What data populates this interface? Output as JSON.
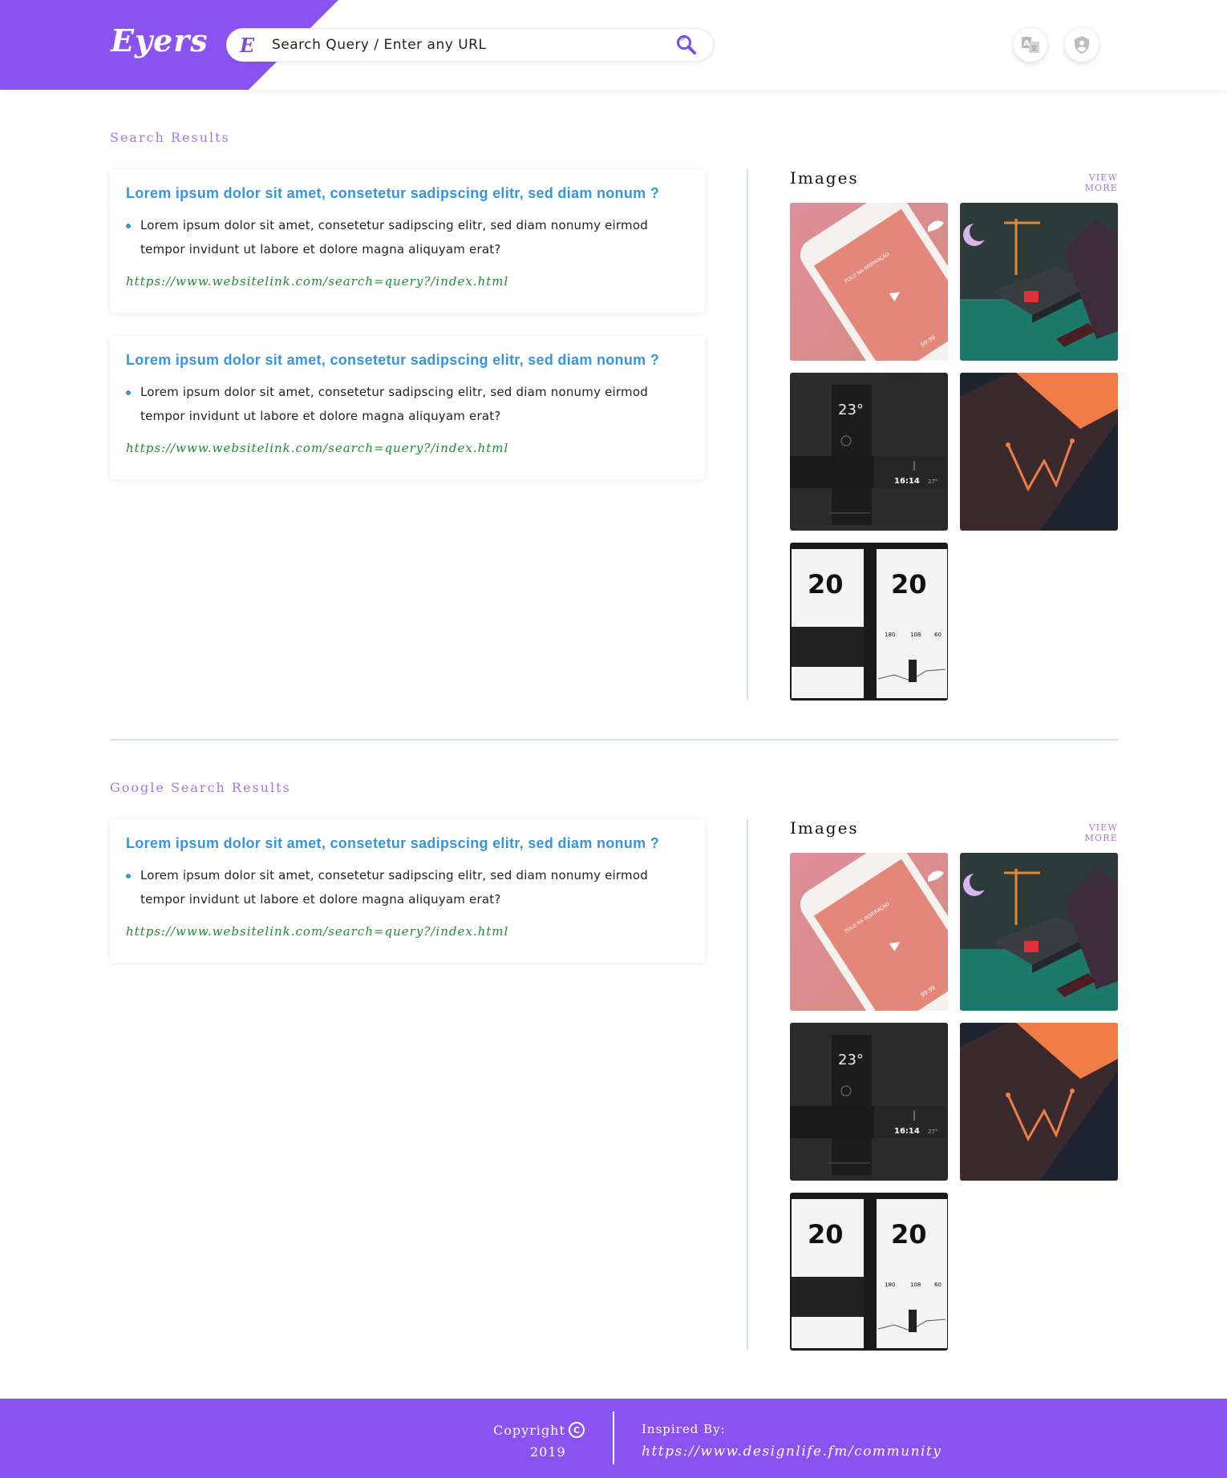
{
  "header": {
    "logo": "Eyers",
    "search_prefix": "E",
    "search_placeholder": "Search Query / Enter any URL",
    "search_icon": "search-icon",
    "icons": [
      "translate-icon",
      "shield-user-icon"
    ],
    "brand_color": "#8a53f0"
  },
  "sections": [
    {
      "title": "Search Results",
      "results": [
        {
          "title": "Lorem ipsum dolor sit amet, consetetur sadipscing elitr, sed diam nonum ?",
          "description": "Lorem ipsum dolor sit amet, consetetur sadipscing elitr, sed diam nonumy eirmod tempor invidunt ut labore et dolore magna aliquyam erat?",
          "url": "https://www.websitelink.com/search=query?/index.html"
        },
        {
          "title": "Lorem ipsum dolor sit amet, consetetur sadipscing elitr, sed diam nonum ?",
          "description": "Lorem ipsum dolor sit amet, consetetur sadipscing elitr, sed diam nonumy eirmod tempor invidunt ut labore et dolore magna aliquyam erat?",
          "url": "https://www.websitelink.com/search=query?/index.html"
        }
      ],
      "images_title": "Images",
      "view_more": "VIEW MORE"
    },
    {
      "title": "Google Search Results",
      "results": [
        {
          "title": "Lorem ipsum dolor sit amet, consetetur sadipscing elitr, sed diam nonum ?",
          "description": "Lorem ipsum dolor sit amet, consetetur sadipscing elitr, sed diam nonumy eirmod tempor invidunt ut labore et dolore magna aliquyam erat?",
          "url": "https://www.websitelink.com/search=query?/index.html"
        }
      ],
      "images_title": "Images",
      "view_more": "VIEW MORE"
    }
  ],
  "thumbnails": {
    "phone_time": "99:99",
    "phone_text": "FOLD NA INSPIRAÇÃO",
    "weather_temp": "23°",
    "weather_time": "16:14",
    "weather_small": "27°",
    "fitness_value": "20",
    "fitness_stats": [
      "180",
      "108",
      "60"
    ]
  },
  "footer": {
    "copyright": "Copyright",
    "copyright_icon": "copyright-icon",
    "year": "2019",
    "inspired_label": "Inspired By:",
    "inspired_link": "https://www.designlife.fm/community"
  }
}
